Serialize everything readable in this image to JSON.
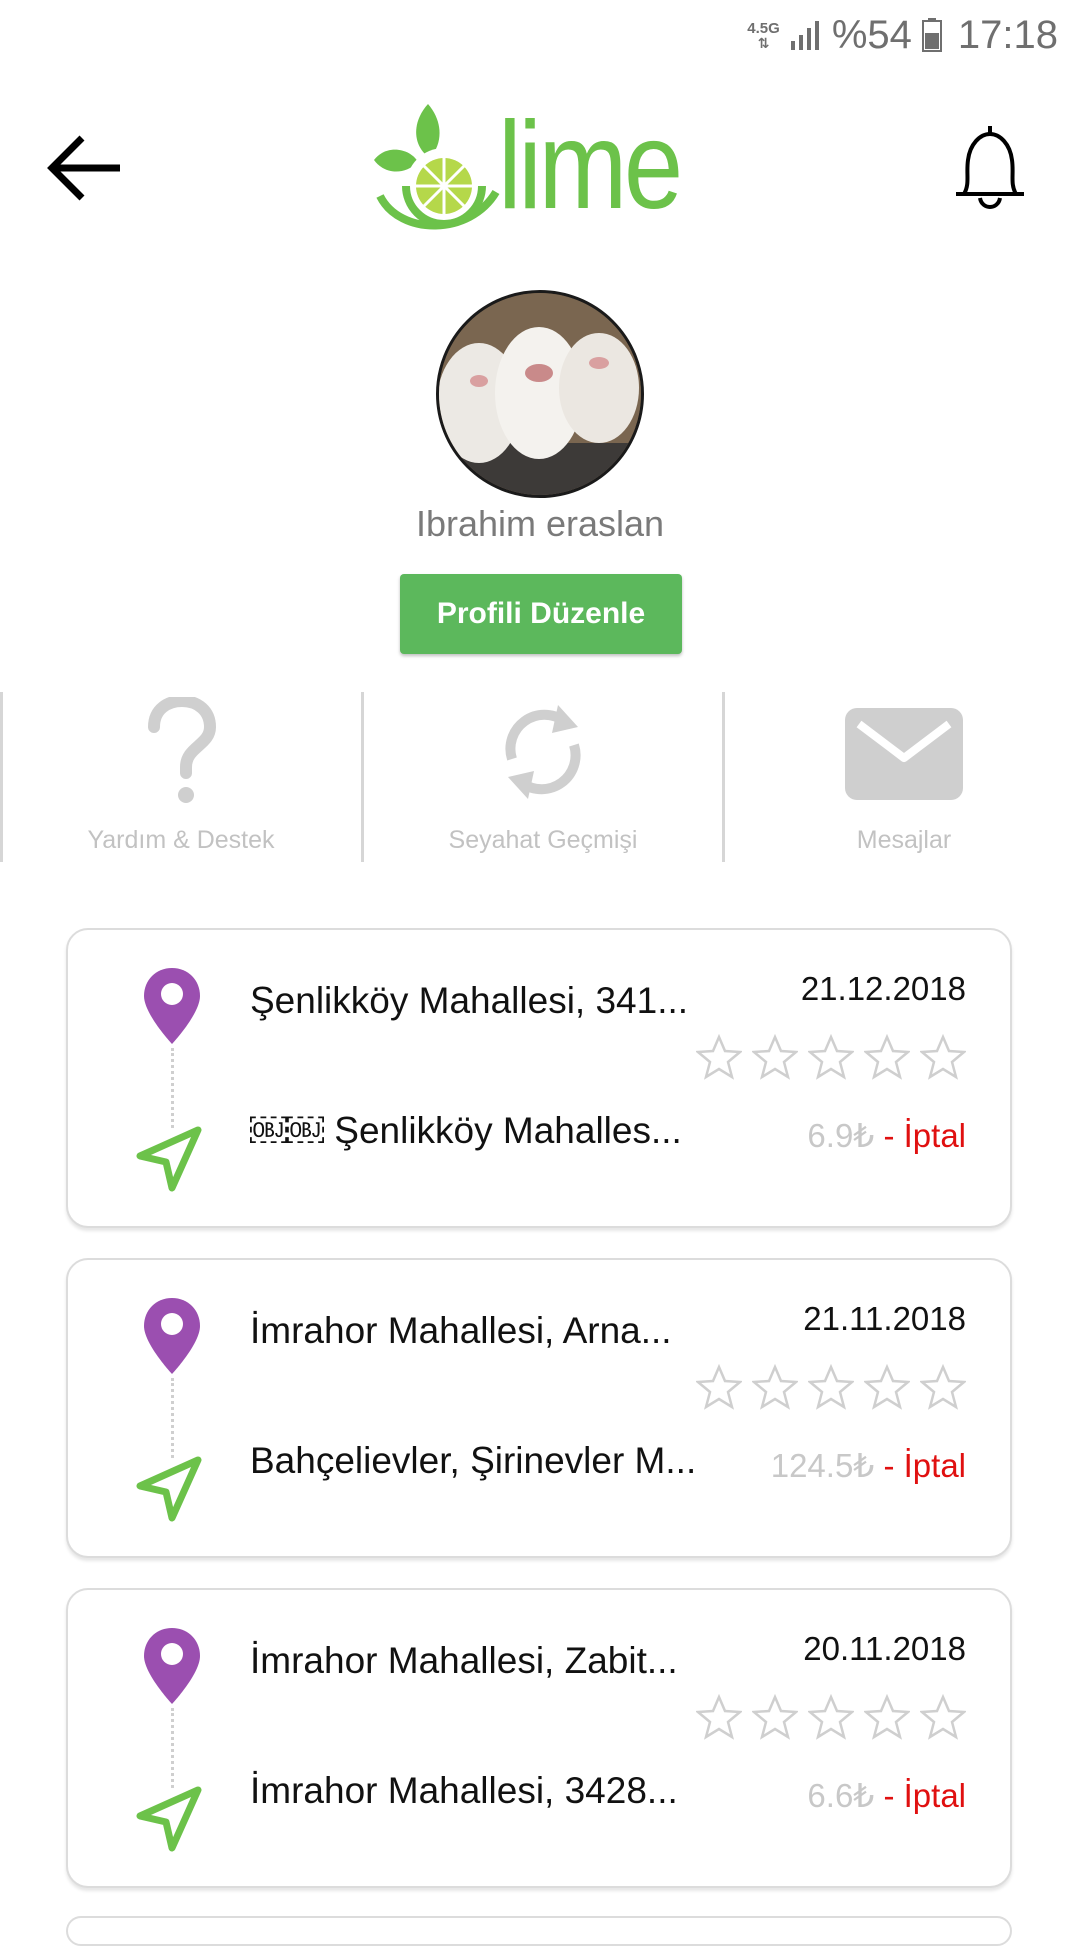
{
  "status_bar": {
    "network": "4.5G",
    "battery": "%54",
    "time": "17:18"
  },
  "header": {
    "back_icon": "arrow-left-icon",
    "logo_text": "lime",
    "notification_icon": "bell-icon"
  },
  "profile": {
    "name": "Ibrahim eraslan",
    "edit_label": "Profili Düzenle"
  },
  "actions": [
    {
      "label": "Yardım & Destek",
      "icon": "question-icon"
    },
    {
      "label": "Seyahat Geçmişi",
      "icon": "refresh-icon"
    },
    {
      "label": "Mesajlar",
      "icon": "envelope-icon"
    }
  ],
  "colors": {
    "brand_green": "#6cc24a",
    "button_green": "#5cb85c",
    "pin_purple": "#9b4fb0",
    "cancel_red": "#e01010"
  },
  "trips": [
    {
      "from": "Şenlikköy Mahallesi, 341...",
      "to": "￼￼ Şenlikköy Mahalles...",
      "date": "21.12.2018",
      "price": "6.9₺",
      "status": " - İptal",
      "rating": 0
    },
    {
      "from": "İmrahor Mahallesi, Arna...",
      "to": "Bahçelievler, Şirinevler M...",
      "date": "21.11.2018",
      "price": "124.5₺",
      "status": " - İptal",
      "rating": 0
    },
    {
      "from": "İmrahor Mahallesi, Zabit...",
      "to": "İmrahor Mahallesi, 3428...",
      "date": "20.11.2018",
      "price": "6.6₺",
      "status": " - İptal",
      "rating": 0
    }
  ]
}
